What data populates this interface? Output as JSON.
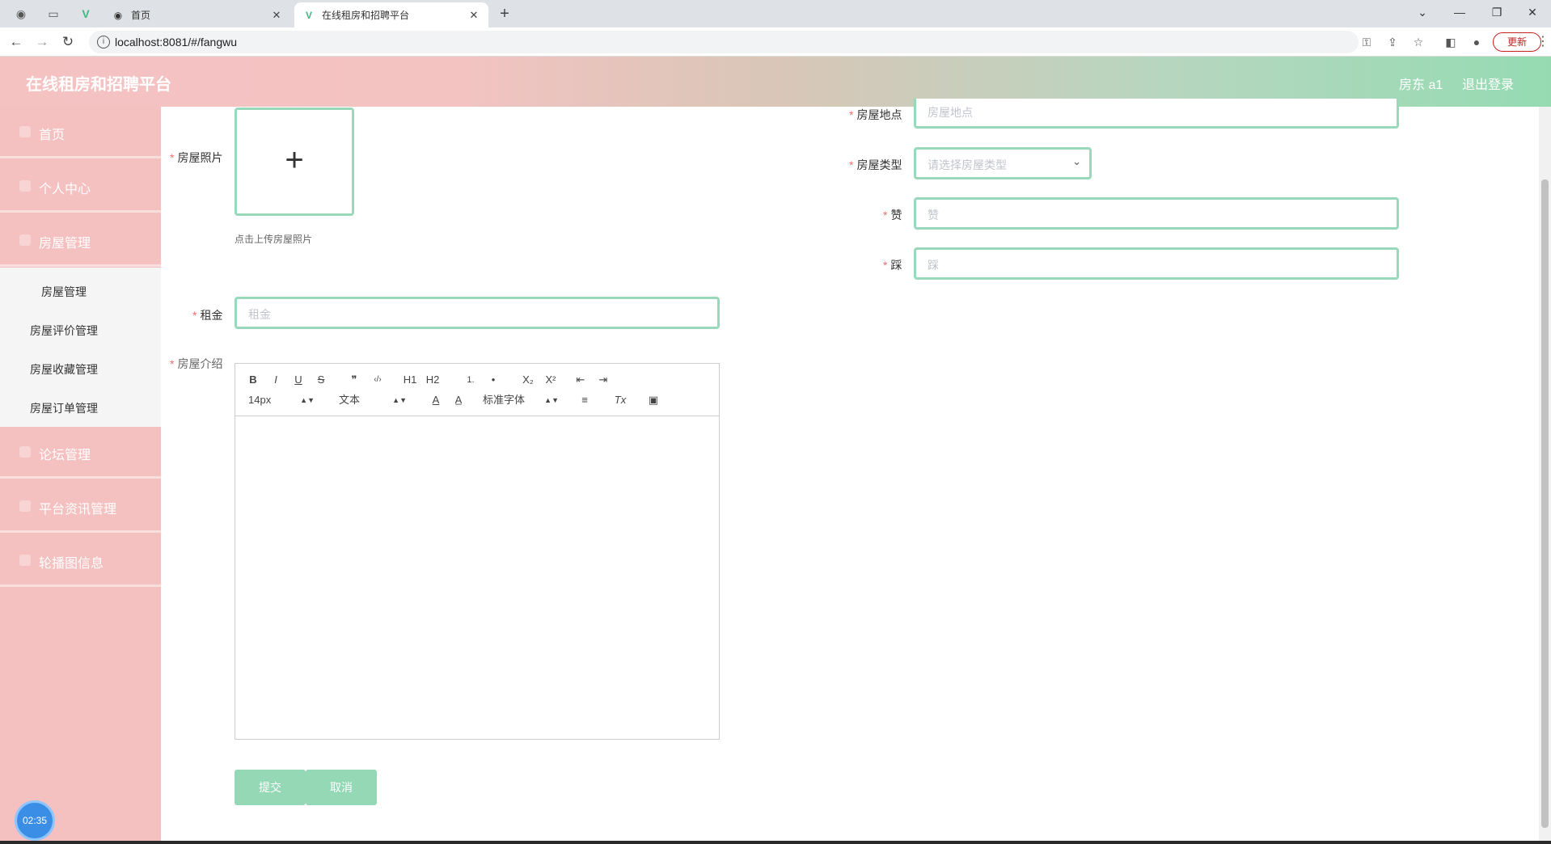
{
  "browser": {
    "tabs": [
      {
        "title": "首页",
        "active": false
      },
      {
        "title": "在线租房和招聘平台",
        "active": true
      }
    ],
    "url": "localhost:8081/#/fangwu",
    "update_label": "更新"
  },
  "header": {
    "brand": "在线租房和招聘平台",
    "user": "房东 a1",
    "logout": "退出登录"
  },
  "sidebar": {
    "items": [
      {
        "label": "首页"
      },
      {
        "label": "个人中心"
      },
      {
        "label": "房屋管理"
      },
      {
        "label": "论坛管理"
      },
      {
        "label": "平台资讯管理"
      },
      {
        "label": "轮播图信息"
      }
    ],
    "submenu": [
      "房屋管理",
      "房屋评价管理",
      "房屋收藏管理",
      "房屋订单管理"
    ],
    "clock": "02:35"
  },
  "form": {
    "photo": {
      "label": "房屋照片",
      "hint": "点击上传房屋照片"
    },
    "rent": {
      "label": "租金",
      "placeholder": "租金"
    },
    "intro": {
      "label": "房屋介绍"
    },
    "location": {
      "label": "房屋地点",
      "placeholder": "房屋地点"
    },
    "type": {
      "label": "房屋类型",
      "placeholder": "请选择房屋类型"
    },
    "like": {
      "label": "赞",
      "placeholder": "赞"
    },
    "dislike": {
      "label": "踩",
      "placeholder": "踩"
    },
    "editor": {
      "font_size": "14px",
      "header": "文本",
      "font": "标准字体",
      "buttons": [
        "B",
        "I",
        "U",
        "S",
        "❞",
        "‹/›",
        "H1",
        "H2",
        "1.",
        "•",
        "X₂",
        "X²",
        "⇤",
        "⇥",
        "A",
        "A̲",
        "≡",
        "Tx",
        "▣"
      ]
    },
    "submit": "提交",
    "cancel": "取消"
  }
}
